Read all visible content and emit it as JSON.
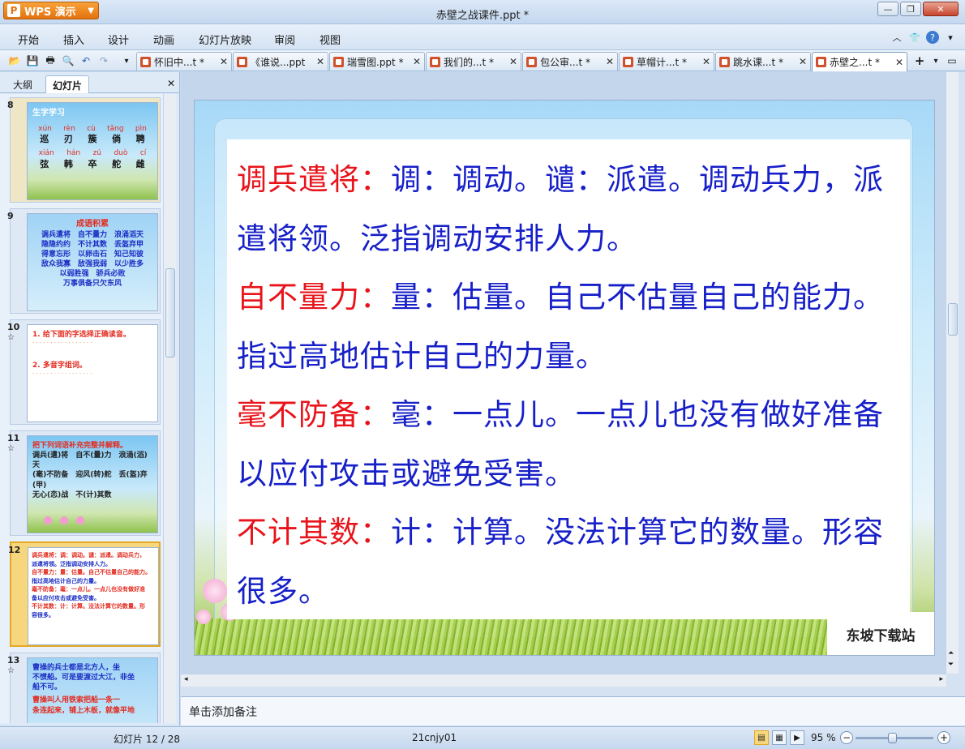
{
  "app": {
    "button_label": "WPS 演示",
    "window_title": "赤壁之战课件.ppt *"
  },
  "menu": [
    "开始",
    "插入",
    "设计",
    "动画",
    "幻灯片放映",
    "审阅",
    "视图"
  ],
  "tabs": [
    {
      "label": "怀旧中...t *"
    },
    {
      "label": "《谁说...ppt"
    },
    {
      "label": "瑞雪图.ppt *"
    },
    {
      "label": "我们的...t *"
    },
    {
      "label": "包公审...t *"
    },
    {
      "label": "草帽计...t *"
    },
    {
      "label": "跳水课...t *"
    },
    {
      "label": "赤壁之...t *"
    }
  ],
  "pane": {
    "tab_outline": "大纲",
    "tab_slides": "幻灯片"
  },
  "thumbnails": [
    {
      "num": "8",
      "title": "生字学习",
      "pinyin1": [
        "xún",
        "rèn",
        "cù",
        "tǎng",
        "pìn"
      ],
      "chars1": [
        "巡",
        "刃",
        "簇",
        "倘",
        "聘"
      ],
      "pinyin2": [
        "xián",
        "hán",
        "zú",
        "duò",
        "cí"
      ],
      "chars2": [
        "弦",
        "韩",
        "卒",
        "舵",
        "雌"
      ]
    },
    {
      "num": "9",
      "title": "成语积累",
      "lines": [
        "调兵遣将　自不量力　浪涌滔天",
        "隐隐约约　不计其数　丢盔弃甲",
        "得意忘形　以卵击石　知己知彼",
        "敌众我寡　敌强我弱　以少胜多",
        "以弱胜强　骄兵必败",
        "万事俱备只欠东风"
      ]
    },
    {
      "num": "10",
      "star": "☆",
      "lines": [
        "1. 给下面的字选择正确读音。",
        "2. 多音字组词。"
      ]
    },
    {
      "num": "11",
      "star": "☆",
      "lines": [
        "把下列词语补充完整并解释。",
        "调兵(遣)将　自不(量)力　浪涌(滔)天",
        "(毫)不防备　迎风(转)舵　丢(盔)弃(甲)",
        "无心(恋)战　不(计)其数"
      ]
    },
    {
      "num": "12",
      "lines": [
        "调兵遣将：调：调动。谴：派遣。调动兵力，",
        "派遣将领。泛指调动安排人力。",
        "自不量力：量：估量。自己不估量自己的能力。",
        "指过高地估计自己的力量。",
        "毫不防备：毫：一点儿。一点儿也没有做好准",
        "备以应付攻击或避免受害。",
        "不计其数：计：计算。没法计算它的数量。形",
        "容很多。"
      ]
    },
    {
      "num": "13",
      "star": "☆",
      "lines": [
        "曹操的兵士都是北方人，坐",
        "不惯船。可是要渡过大江，非坐",
        "船不可。",
        "曹操叫人用铁索把船一条一",
        "条连起来，铺上木板，就像平地"
      ]
    }
  ],
  "slide": {
    "paragraphs": [
      {
        "term": "调兵遣将：",
        "text": "调：调动。谴：派遣。调动兵力，派遣将领。泛指调动安排人力。"
      },
      {
        "term": "自不量力：",
        "text": "量：估量。自己不估量自己的能力。指过高地估计自己的力量。"
      },
      {
        "term": "毫不防备：",
        "text": "毫：一点儿。一点儿也没有做好准备以应付攻击或避免受害。"
      },
      {
        "term": "不计其数：",
        "text": "计：计算。没法计算它的数量。形容很多。"
      }
    ],
    "watermark": "东坡下载站"
  },
  "notes_placeholder": "单击添加备注",
  "status": {
    "slide_counter": "幻灯片 12 / 28",
    "template": "21cnjy01",
    "zoom": "95 %"
  },
  "colors": {
    "term": "#e8141b",
    "body": "#1720c8",
    "accent": "#e4720e"
  }
}
